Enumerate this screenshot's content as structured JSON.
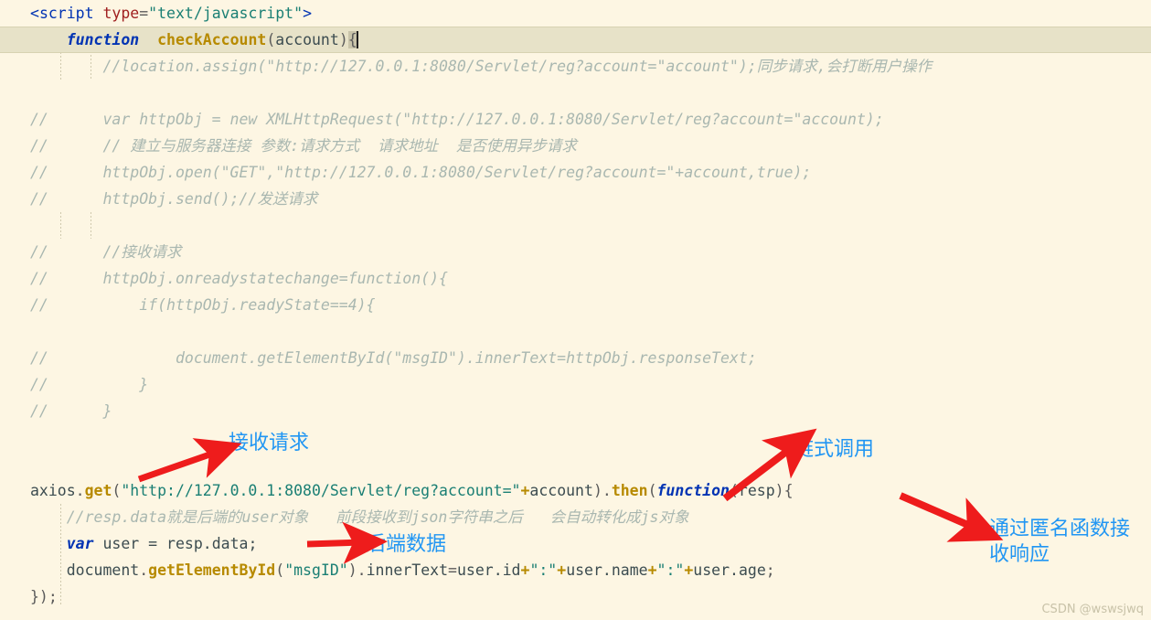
{
  "editor": {
    "theme_background": "#fdf6e3",
    "current_line_background": "#e7e2c8",
    "lines": [
      {
        "id": "l1",
        "text": "<script type=\"text/javascript\">"
      },
      {
        "id": "l2",
        "text": "    function  checkAccount(account){"
      },
      {
        "id": "l3",
        "text": "        //location.assign(\"http://127.0.0.1:8080/Servlet/reg?account=\"account\");同步请求,会打断用户操作"
      },
      {
        "id": "l4",
        "text": ""
      },
      {
        "id": "l5",
        "text": "//      var httpObj = new XMLHttpRequest(\"http://127.0.0.1:8080/Servlet/reg?account=\"account);"
      },
      {
        "id": "l6",
        "text": "//      // 建立与服务器连接 参数:请求方式  请求地址  是否使用异步请求"
      },
      {
        "id": "l7",
        "text": "//      httpObj.open(\"GET\",\"http://127.0.0.1:8080/Servlet/reg?account=\"+account,true);"
      },
      {
        "id": "l8",
        "text": "//      httpObj.send();//发送请求"
      },
      {
        "id": "l9",
        "text": ""
      },
      {
        "id": "l10",
        "text": "//      //接收请求"
      },
      {
        "id": "l11",
        "text": "//      httpObj.onreadystatechange=function(){"
      },
      {
        "id": "l12",
        "text": "//          if(httpObj.readyState==4){"
      },
      {
        "id": "l13",
        "text": ""
      },
      {
        "id": "l14",
        "text": "//              document.getElementById(\"msgID\").innerText=httpObj.responseText;"
      },
      {
        "id": "l15",
        "text": "//          }"
      },
      {
        "id": "l16",
        "text": "//      }"
      },
      {
        "id": "l17",
        "text": ""
      },
      {
        "id": "l18",
        "text": ""
      },
      {
        "id": "l19",
        "text": "axios.get(\"http://127.0.0.1:8080/Servlet/reg?account=\"+account).then(function(resp){"
      },
      {
        "id": "l20",
        "text": "    //resp.data就是后端的user对象   前段接收到json字符串之后   会自动转化成js对象"
      },
      {
        "id": "l21",
        "text": "    var user = resp.data;"
      },
      {
        "id": "l22",
        "text": "    document.getElementById(\"msgID\").innerText=user.id+\":\"+user.name+\":\"+user.age;"
      },
      {
        "id": "l23",
        "text": "});"
      }
    ],
    "tokens": {
      "script_open_lt": "<",
      "script_tag": "script",
      "script_space": " ",
      "script_attr": "type",
      "script_eq": "=",
      "script_attr_value": "\"text/javascript\"",
      "script_close_gt": ">",
      "kw_function": "function",
      "fn_checkAccount": "checkAccount",
      "paren_account_open": "(",
      "param_account": "account",
      "paren_account_close": ")",
      "brace_open": "{",
      "comment_location": "//location.assign(\"http://127.0.0.1:8080/Servlet/reg?account=\"account\");同步请求,会打断用户操作",
      "comment_slashes": "//",
      "comment_var_http": "      var httpObj = new XMLHttpRequest(\"http://127.0.0.1:8080/Servlet/reg?account=\"account);",
      "comment_connect": "      // 建立与服务器连接 参数:请求方式  请求地址  是否使用异步请求",
      "comment_open": "      httpObj.open(\"GET\",\"http://127.0.0.1:8080/Servlet/reg?account=\"+account,true);",
      "comment_send": "      httpObj.send();//发送请求",
      "comment_receive": "      //接收请求",
      "comment_onready": "      httpObj.onreadystatechange=function(){",
      "comment_ifready": "          if(httpObj.readyState==4){",
      "comment_getelem": "              document.getElementById(\"msgID\").innerText=httpObj.responseText;",
      "comment_close_inner": "          }",
      "comment_close_outer": "      }",
      "axios_obj": "axios",
      "axios_dot": ".",
      "axios_get": "get",
      "axios_paren_open": "(",
      "axios_url": "\"http://127.0.0.1:8080/Servlet/reg?account=\"",
      "axios_plus": "+",
      "axios_account": "account",
      "axios_paren_close": ")",
      "then_dot": ".",
      "then_name": "then",
      "then_paren_open": "(",
      "then_kw_function": "function",
      "then_arg_open": "(",
      "then_arg_resp": "resp",
      "then_arg_close": ")",
      "then_brace_open": "{",
      "comment_respdata": "//resp.data就是后端的user对象   前段接收到json字符串之后   会自动转化成js对象",
      "kw_var": "var",
      "var_user": " user = resp.data;",
      "doc_getelem_prefix": "document",
      "doc_dot1": ".",
      "doc_getelem": "getElementById",
      "doc_paren_open": "(",
      "doc_msgid": "\"msgID\"",
      "doc_paren_close": ")",
      "doc_dot2": ".",
      "doc_innertext": "innerText",
      "doc_eq": "=",
      "doc_userid": "user.id",
      "doc_plus1": "+",
      "doc_colon1": "\":\"",
      "doc_plus2": "+",
      "doc_username": "user.name",
      "doc_plus3": "+",
      "doc_colon2": "\":\"",
      "doc_plus4": "+",
      "doc_userage": "user.age",
      "doc_semi": ";",
      "closing": "});"
    }
  },
  "annotations": {
    "color": "#2196f3",
    "arrow_color": "#ee1c1c",
    "items": [
      {
        "id": "a1",
        "label": "接收请求",
        "meaning": "receive-request"
      },
      {
        "id": "a2",
        "label": "链式调用",
        "meaning": "chained-call"
      },
      {
        "id": "a3",
        "label": "后端数据",
        "meaning": "backend-data"
      },
      {
        "id": "a4",
        "label": "通过匿名函数接\n收响应",
        "meaning": "receive-response-via-anonymous-function"
      }
    ]
  },
  "watermark": {
    "text": "CSDN @wswsjwq"
  }
}
